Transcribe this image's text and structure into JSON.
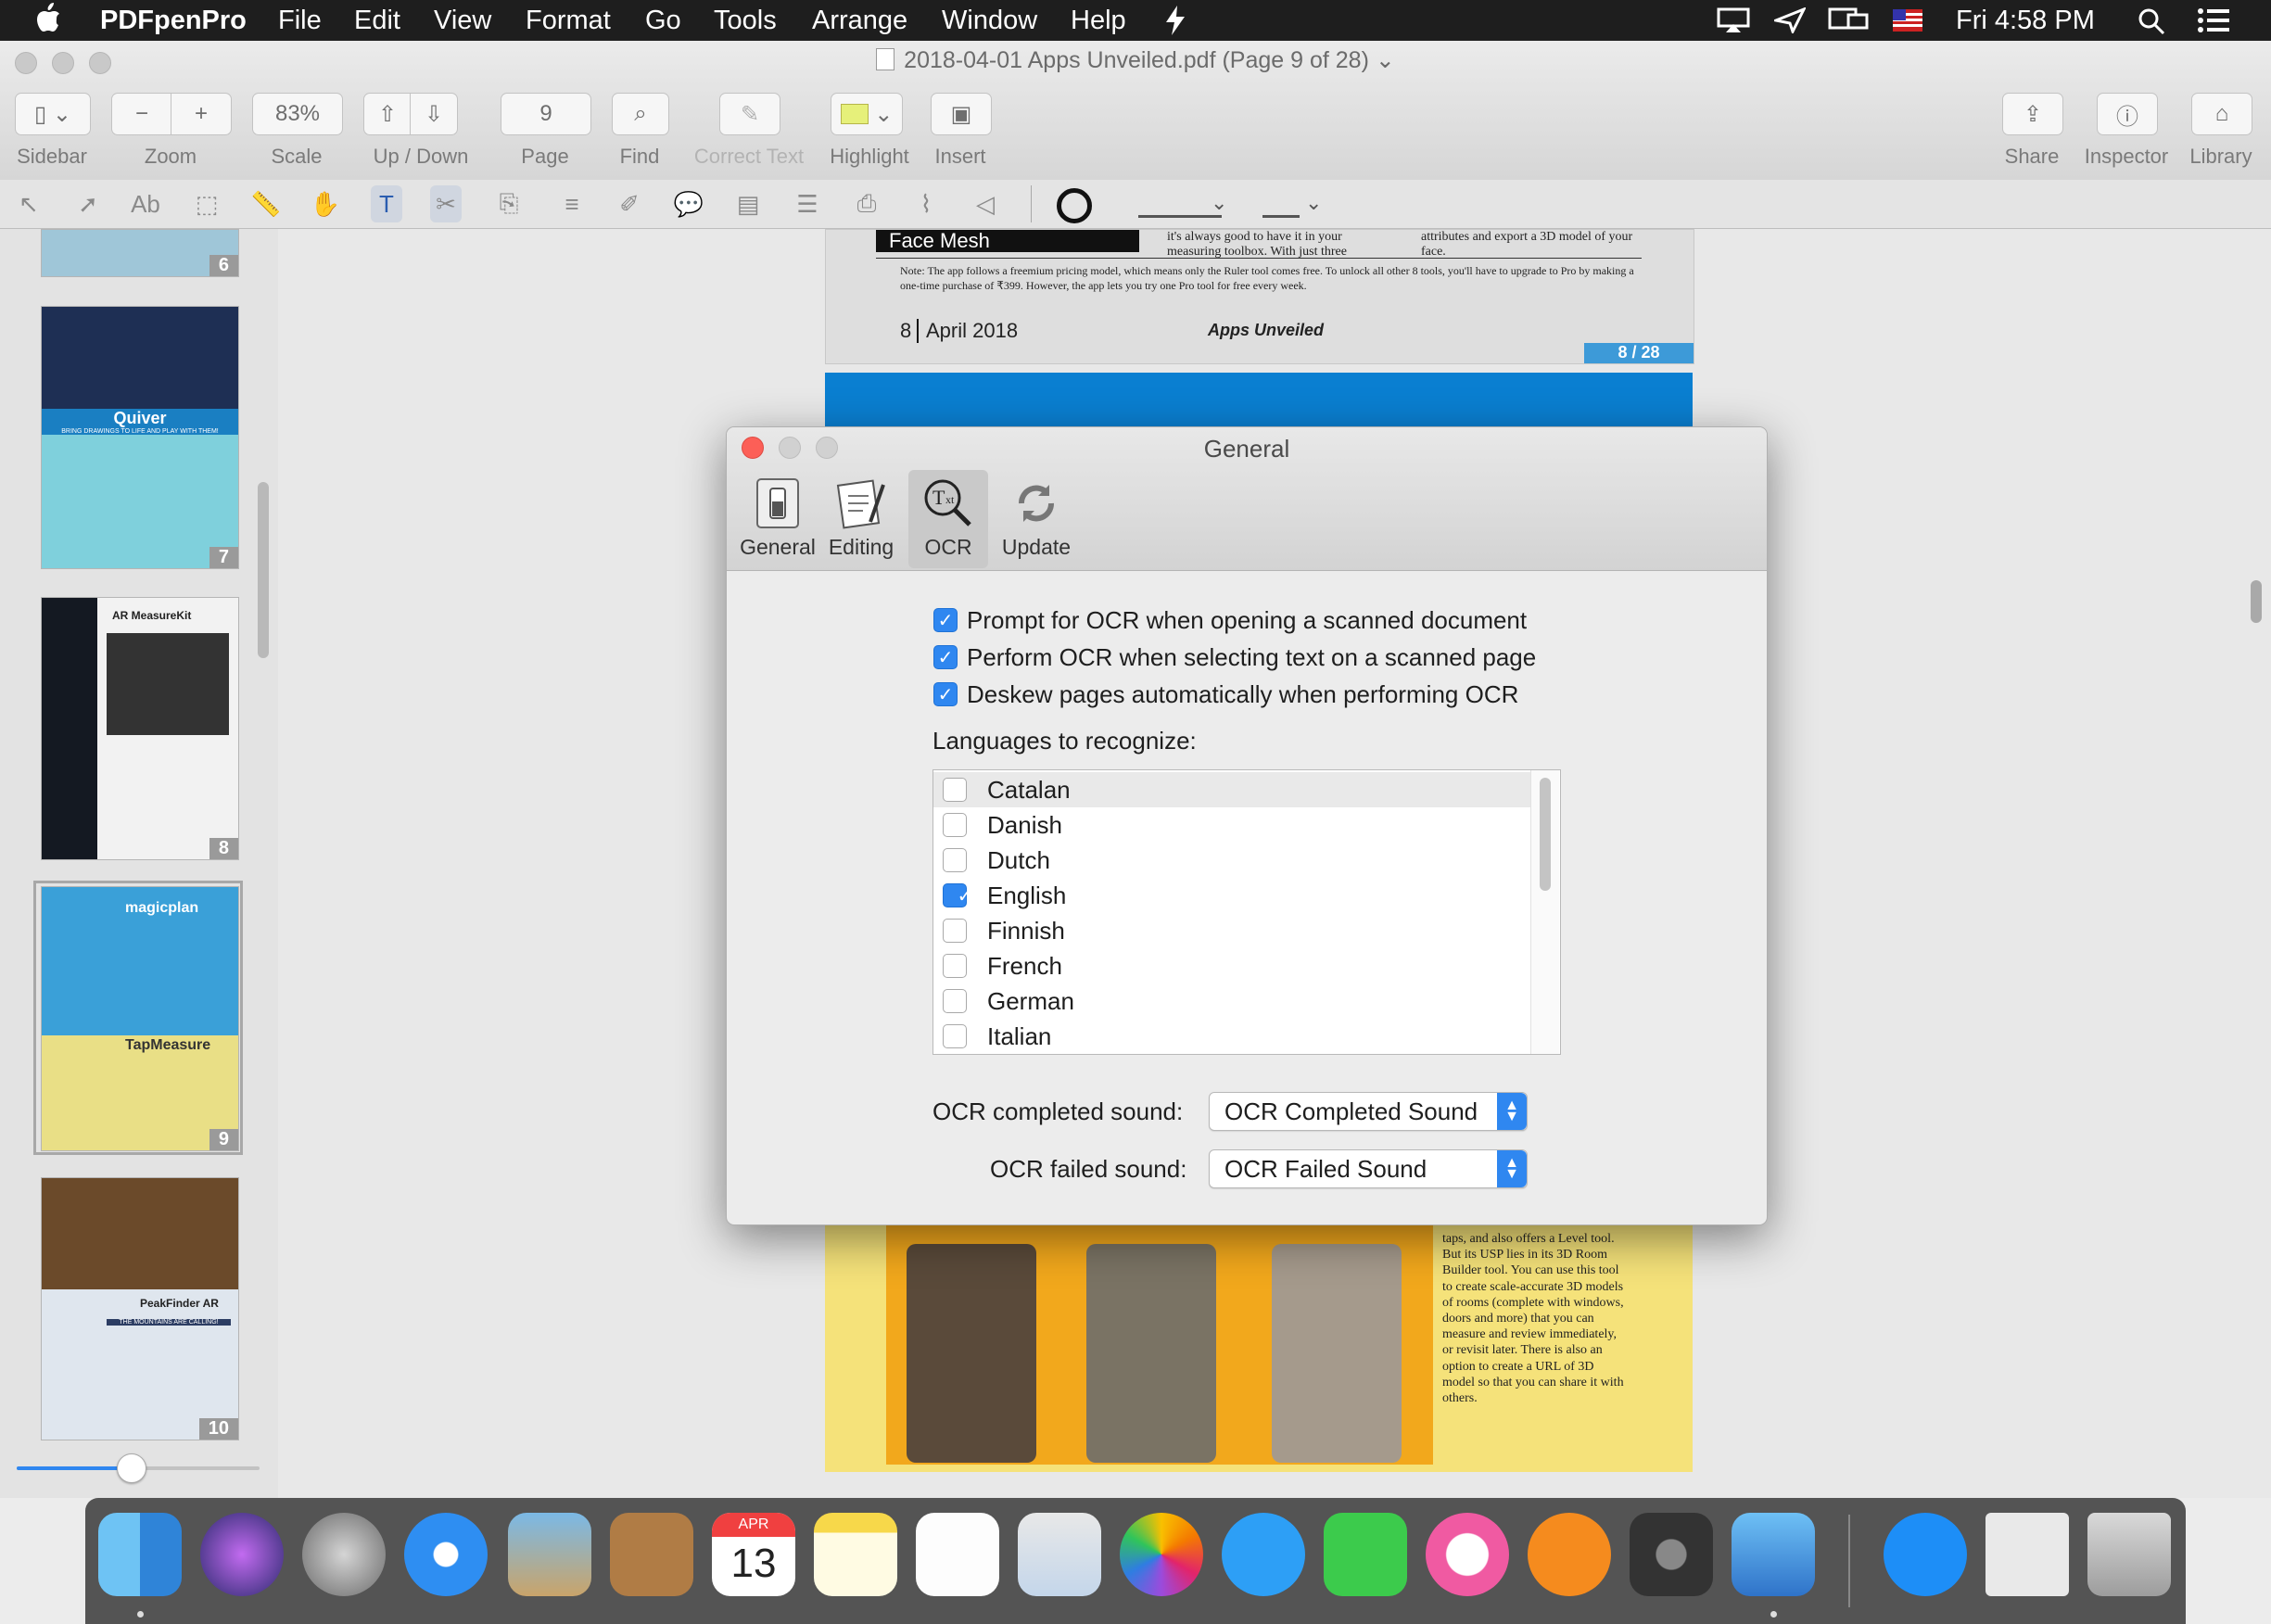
{
  "menubar": {
    "app_name": "PDFpenPro",
    "menus": [
      "File",
      "Edit",
      "View",
      "Format",
      "Go",
      "Tools",
      "Arrange",
      "Window",
      "Help"
    ],
    "clock": "Fri 4:58 PM"
  },
  "window": {
    "title": "2018-04-01 Apps Unveiled.pdf (Page 9 of 28)",
    "toolbar": {
      "sidebar_label": "Sidebar",
      "zoom_label": "Zoom",
      "zoom_minus": "−",
      "zoom_plus": "+",
      "scale_value": "83%",
      "scale_label": "Scale",
      "updown_label": "Up / Down",
      "page_value": "9",
      "page_label": "Page",
      "find_label": "Find",
      "correct_text_label": "Correct Text",
      "highlight_label": "Highlight",
      "insert_label": "Insert",
      "share_label": "Share",
      "inspector_label": "Inspector",
      "library_label": "Library"
    }
  },
  "sidebar": {
    "thumbnails": [
      {
        "num": "6"
      },
      {
        "num": "7",
        "title": "Quiver",
        "subtitle": "BRING DRAWINGS TO LIFE AND PLAY WITH THEM!"
      },
      {
        "num": "8",
        "title": "AR MeasureKit"
      },
      {
        "num": "9",
        "title": "magicplan",
        "title2": "TapMeasure"
      },
      {
        "num": "10",
        "title": "PeakFinder AR",
        "subtitle": "THE MOUNTAINS ARE CALLING!"
      }
    ]
  },
  "document": {
    "page8": {
      "heading": "Face Mesh",
      "col1": "it's always good to have it in your measuring toolbox. With just three",
      "col2": "attributes and export a 3D model of your face.",
      "note": "Note: The app follows a freemium pricing model, which means only the Ruler tool comes free. To unlock all other 8 tools, you'll have to upgrade to Pro by making a one-time purchase of ₹399. However, the app lets you try one Pro tool for free every week.",
      "footer_num": "8",
      "footer_date": "April 2018",
      "footer_brand": "Apps Unveiled",
      "page_badge": "8 / 28"
    },
    "page9_text": "taps, and also offers a Level tool. But its USP lies in its 3D Room Builder tool. You can use this tool to create scale-accurate 3D models of rooms (complete with windows, doors and more) that you can measure and review immediately, or revisit later. There is also an option to create a URL of 3D model so that you can share it with others."
  },
  "dialog": {
    "title": "General",
    "tabs": [
      {
        "label": "General",
        "icon": "switch-icon"
      },
      {
        "label": "Editing",
        "icon": "editing-icon"
      },
      {
        "label": "OCR",
        "icon": "ocr-icon",
        "selected": true
      },
      {
        "label": "Update",
        "icon": "update-icon"
      }
    ],
    "options": [
      {
        "label": "Prompt for OCR when opening a scanned document",
        "checked": true
      },
      {
        "label": "Perform OCR when selecting text on a scanned page",
        "checked": true
      },
      {
        "label": "Deskew pages automatically when performing OCR",
        "checked": true
      }
    ],
    "languages_label": "Languages to recognize:",
    "languages": [
      {
        "name": "Catalan",
        "checked": false
      },
      {
        "name": "Danish",
        "checked": false
      },
      {
        "name": "Dutch",
        "checked": false
      },
      {
        "name": "English",
        "checked": true
      },
      {
        "name": "Finnish",
        "checked": false
      },
      {
        "name": "French",
        "checked": false
      },
      {
        "name": "German",
        "checked": false
      },
      {
        "name": "Italian",
        "checked": false
      }
    ],
    "completed_sound_label": "OCR completed sound:",
    "completed_sound_value": "OCR Completed Sound",
    "failed_sound_label": "OCR failed sound:",
    "failed_sound_value": "OCR Failed Sound"
  },
  "dock": {
    "calendar_month": "APR",
    "calendar_day": "13"
  },
  "colors": {
    "accent": "#2f87f0",
    "close": "#fc5f57",
    "page9_blue": "#0a7fd1",
    "page9_yellow": "#f5e27a"
  }
}
